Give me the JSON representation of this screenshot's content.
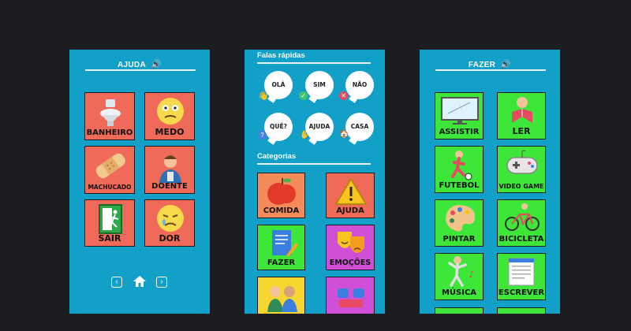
{
  "screen1": {
    "title": "AJUDA",
    "tiles": [
      {
        "label": "BANHEIRO",
        "icon": "toilet-icon"
      },
      {
        "label": "MEDO",
        "icon": "scared-face-icon"
      },
      {
        "label": "MACHUCADO",
        "icon": "bandage-icon"
      },
      {
        "label": "DOENTE",
        "icon": "sick-person-icon"
      },
      {
        "label": "SAIR",
        "icon": "exit-sign-icon"
      },
      {
        "label": "DOR",
        "icon": "crying-face-icon"
      }
    ],
    "nav": {
      "prev": "‹",
      "home": "⌂",
      "next": "›"
    }
  },
  "screen2": {
    "quick_title": "Falas rápidas",
    "bubbles": [
      {
        "label": "OLÁ",
        "icon": "wave-hand-icon"
      },
      {
        "label": "SIM",
        "icon": "check-icon"
      },
      {
        "label": "NÃO",
        "icon": "x-icon"
      },
      {
        "label": "QUÊ?",
        "icon": "question-icon"
      },
      {
        "label": "AJUDA",
        "icon": "helping-hand-icon"
      },
      {
        "label": "CASA",
        "icon": "house-icon"
      }
    ],
    "categories_title": "Categorias",
    "categories": [
      {
        "label": "COMIDA",
        "color": "#f58a5a",
        "icon": "apple-icon"
      },
      {
        "label": "AJUDA",
        "color": "#f06a5a",
        "icon": "warning-icon"
      },
      {
        "label": "FAZER",
        "color": "#3ee63a",
        "icon": "notepad-pencil-icon"
      },
      {
        "label": "EMOÇÕES",
        "color": "#cf4fd6",
        "icon": "theater-masks-icon"
      },
      {
        "label": "",
        "color": "#f7d630",
        "icon": "people-icon"
      },
      {
        "label": "",
        "color": "#cf4fd6",
        "icon": "friends-icon"
      }
    ]
  },
  "screen3": {
    "title": "FAZER",
    "tiles": [
      {
        "label": "ASSISTIR",
        "icon": "tv-icon"
      },
      {
        "label": "LER",
        "icon": "reading-icon"
      },
      {
        "label": "FUTEBOL",
        "icon": "soccer-icon"
      },
      {
        "label": "VIDEO GAME",
        "icon": "gamepad-icon"
      },
      {
        "label": "PINTAR",
        "icon": "palette-icon"
      },
      {
        "label": "BICICLETA",
        "icon": "bicycle-icon"
      },
      {
        "label": "MÚSICA",
        "icon": "music-dance-icon"
      },
      {
        "label": "ESCREVER",
        "icon": "writing-pad-icon"
      }
    ]
  }
}
